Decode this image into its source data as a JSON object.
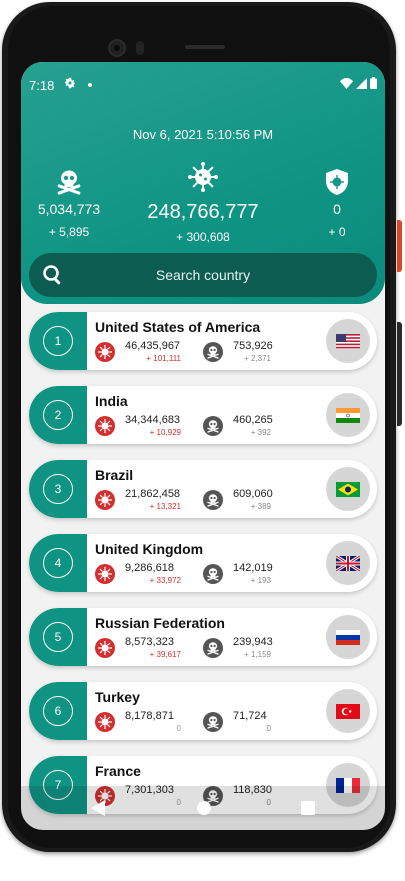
{
  "status_bar": {
    "time": "7:18"
  },
  "header": {
    "datetime": "Nov 6, 2021 5:10:56 PM",
    "deaths": {
      "total": "5,034,773",
      "delta": "+ 5,895"
    },
    "cases": {
      "total": "248,766,777",
      "delta": "+ 300,608"
    },
    "recovered": {
      "total": "0",
      "delta": "+ 0"
    }
  },
  "search": {
    "placeholder": "Search country"
  },
  "countries": [
    {
      "rank": "1",
      "name": "United States of America",
      "cases": "46,435,967",
      "cases_delta": "+ 101,111",
      "deaths": "753,926",
      "deaths_delta": "+ 2,371",
      "flag": "usa-flag-icon"
    },
    {
      "rank": "2",
      "name": "India",
      "cases": "34,344,683",
      "cases_delta": "+ 10,929",
      "deaths": "460,265",
      "deaths_delta": "+ 392",
      "flag": "india-flag-icon"
    },
    {
      "rank": "3",
      "name": "Brazil",
      "cases": "21,862,458",
      "cases_delta": "+ 13,321",
      "deaths": "609,060",
      "deaths_delta": "+ 389",
      "flag": "brazil-flag-icon"
    },
    {
      "rank": "4",
      "name": "United Kingdom",
      "cases": "9,286,618",
      "cases_delta": "+ 33,972",
      "deaths": "142,019",
      "deaths_delta": "+ 193",
      "flag": "uk-flag-icon"
    },
    {
      "rank": "5",
      "name": "Russian Federation",
      "cases": "8,573,323",
      "cases_delta": "+ 39,617",
      "deaths": "239,943",
      "deaths_delta": "+ 1,159",
      "flag": "russia-flag-icon"
    },
    {
      "rank": "6",
      "name": "Turkey",
      "cases": "8,178,871",
      "cases_delta": "0",
      "deaths": "71,724",
      "deaths_delta": "0",
      "flag": "turkey-flag-icon"
    },
    {
      "rank": "7",
      "name": "France",
      "cases": "7,301,303",
      "cases_delta": "0",
      "deaths": "118,830",
      "deaths_delta": "0",
      "flag": "france-flag-icon"
    }
  ],
  "colors": {
    "accent": "#0f9484",
    "search_bg": "#0c5c52",
    "delta_red": "#d32f2f"
  }
}
